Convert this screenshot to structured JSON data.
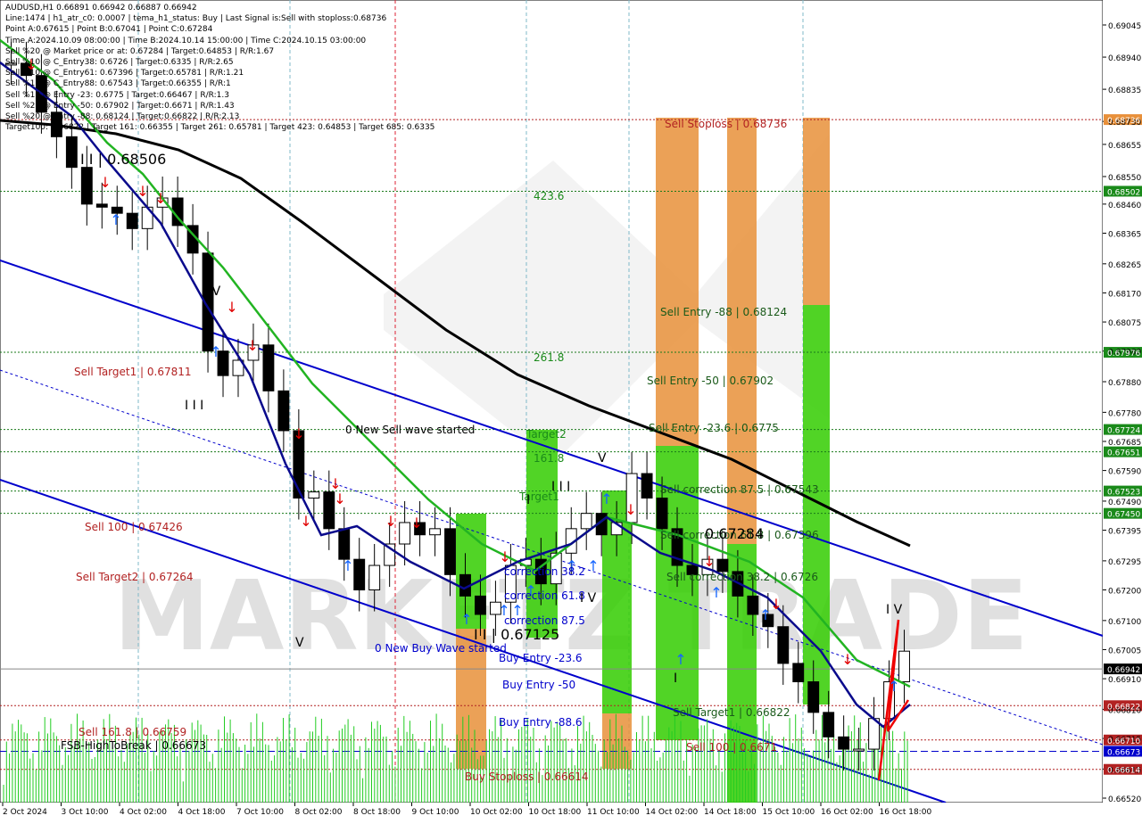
{
  "header": {
    "lines": [
      "AUDUSD,H1  0.66891 0.66942 0.66887 0.66942",
      "Line:1474 | h1_atr_c0: 0.0007 | tema_h1_status: Buy | Last Signal is:Sell with stoploss:0.68736",
      "Point A:0.67615 | Point B:0.67041 | Point C:0.67284",
      "Time A:2024.10.09 08:00:00 | Time B:2024.10.14 15:00:00 | Time C:2024.10.15 03:00:00",
      "Sell %20 @ Market price or at: 0.67284 | Target:0.64853 | R/R:1.67",
      "Sell %10 @ C_Entry38: 0.6726 | Target:0.6335 | R/R:2.65",
      "Sell %10 @ C_Entry61: 0.67396 | Target:0.65781 | R/R:1.21",
      "Sell %10 @ C_Entry88: 0.67543 | Target:0.66355 | R/R:1",
      "Sell %10 @ Entry -23: 0.6775 | Target:0.66467 | R/R:1.3",
      "Sell %20 @ Entry -50: 0.67902 | Target:0.6671 | R/R:1.43",
      "Sell %20 @ Entry -88: 0.68124 | Target:0.66822 | R/R:2.13",
      "Target100: 0.66822 | Target 161: 0.66355 | Target 261: 0.65781 | Target 423: 0.64853 | Target 685: 0.6335"
    ]
  },
  "watermark": "MARKETZ TRADE",
  "colors": {
    "background": "#ffffff",
    "bull_candle": "#000000",
    "bear_candle": "#000000",
    "ma_green": "#22b422",
    "ma_navy": "#0a0a8c",
    "ma_black": "#000000",
    "channel": "#0000cc",
    "dashed_red": "#b22222",
    "dashed_green": "#1a7a1a",
    "zone_green": "#33cc00",
    "zone_orange": "#e8903a",
    "label_red": "#b22222",
    "label_green": "#1a8a1a",
    "arrow_red": "#e00000",
    "arrow_blue": "#1565ff"
  },
  "price_axis": {
    "ticks": [
      "0.69045",
      "0.68940",
      "0.68835",
      "0.68730",
      "0.68655",
      "0.68550",
      "0.68460",
      "0.68365",
      "0.68265",
      "0.68170",
      "0.68075",
      "0.67980",
      "0.67880",
      "0.67780",
      "0.67685",
      "0.67590",
      "0.67490",
      "0.67395",
      "0.67295",
      "0.67200",
      "0.67100",
      "0.67005",
      "0.66910",
      "0.66810",
      "0.66715",
      "0.66615",
      "0.66520"
    ],
    "highlights": [
      {
        "label": "0.68736",
        "color": "#e8903a"
      },
      {
        "label": "0.68502",
        "color": "#1a8a1a"
      },
      {
        "label": "0.67976",
        "color": "#1a8a1a"
      },
      {
        "label": "0.67724",
        "color": "#1a8a1a"
      },
      {
        "label": "0.67651",
        "color": "#1a8a1a"
      },
      {
        "label": "0.67523",
        "color": "#1a8a1a"
      },
      {
        "label": "0.67450",
        "color": "#1a8a1a"
      },
      {
        "label": "0.66942",
        "color": "#000000"
      },
      {
        "label": "0.66822",
        "color": "#b22222"
      },
      {
        "label": "0.66710",
        "color": "#b22222"
      },
      {
        "label": "0.66673",
        "color": "#0000cc"
      },
      {
        "label": "0.66614",
        "color": "#b22222"
      }
    ]
  },
  "time_axis": {
    "labels": [
      "2 Oct 2024",
      "3 Oct 10:00",
      "4 Oct 02:00",
      "4 Oct 18:00",
      "7 Oct 10:00",
      "8 Oct 02:00",
      "8 Oct 18:00",
      "9 Oct 10:00",
      "10 Oct 02:00",
      "10 Oct 18:00",
      "11 Oct 10:00",
      "14 Oct 02:00",
      "14 Oct 18:00",
      "15 Oct 10:00",
      "16 Oct 02:00",
      "16 Oct 18:00"
    ]
  },
  "annotations": [
    {
      "text": "Sell Stoploss | 0.68736",
      "color": "#b22222"
    },
    {
      "text": "423.6",
      "color": "#1a8a1a"
    },
    {
      "text": "261.8",
      "color": "#1a8a1a"
    },
    {
      "text": "Sell Entry -88 | 0.68124",
      "color": "#1a5a1a"
    },
    {
      "text": "Sell Entry -50 | 0.67902",
      "color": "#1a5a1a"
    },
    {
      "text": "Sell Entry -23.6 | 0.6775",
      "color": "#1a5a1a"
    },
    {
      "text": "Sell correction 87.5 | 0.67543",
      "color": "#1a5a1a"
    },
    {
      "text": "Sell correction 61.8 | 0.67396",
      "color": "#1a5a1a"
    },
    {
      "text": "Sell correction 38.2 | 0.6726",
      "color": "#1a5a1a"
    },
    {
      "text": "0.67284",
      "color": "#000000"
    },
    {
      "text": "Sell Target1 | 0.66822",
      "color": "#1a5a1a"
    },
    {
      "text": "Sell 100 | 0.6671",
      "color": "#b22222"
    },
    {
      "text": "Sell Target1 | 0.67811",
      "color": "#b22222"
    },
    {
      "text": "Sell 100 | 0.67426",
      "color": "#b22222"
    },
    {
      "text": "Sell Target2 | 0.67264",
      "color": "#b22222"
    },
    {
      "text": "Sell 161.8 | 0.66759",
      "color": "#b22222"
    },
    {
      "text": "FSB-HighToBreak | 0.66673",
      "color": "#000000"
    },
    {
      "text": "0 New Sell wave started",
      "color": "#000000"
    },
    {
      "text": "0 New Buy Wave started",
      "color": "#0000cc"
    },
    {
      "text": "Buy Entry -23.6",
      "color": "#0000cc"
    },
    {
      "text": "Buy Entry -50",
      "color": "#0000cc"
    },
    {
      "text": "Buy Entry -88.6",
      "color": "#0000cc"
    },
    {
      "text": "Buy Stoploss | 0.66614",
      "color": "#b22222"
    },
    {
      "text": "correction 38.2",
      "color": "#0000cc"
    },
    {
      "text": "correction 61.8",
      "color": "#0000cc"
    },
    {
      "text": "correction 87.5",
      "color": "#0000cc"
    },
    {
      "text": "I I | 0.67125",
      "color": "#000000"
    },
    {
      "text": "I I | 0.68506",
      "color": "#000000"
    },
    {
      "text": "Target2",
      "color": "#1a8a1a"
    },
    {
      "text": "Target1",
      "color": "#1a8a1a"
    },
    {
      "text": "161.8",
      "color": "#1a8a1a"
    },
    {
      "text": "I V",
      "color": "#000000"
    },
    {
      "text": "I I I",
      "color": "#000000"
    },
    {
      "text": "V",
      "color": "#000000"
    },
    {
      "text": "I I I",
      "color": "#000000"
    },
    {
      "text": "V",
      "color": "#000000"
    },
    {
      "text": "I V",
      "color": "#000000"
    },
    {
      "text": "I V",
      "color": "#000000"
    },
    {
      "text": "I",
      "color": "#000000"
    },
    {
      "text": "I",
      "color": "#000000"
    }
  ],
  "chart_data": {
    "type": "candlestick",
    "symbol": "AUDUSD,H1",
    "ylim": [
      0.6652,
      0.69045
    ],
    "x": [
      "2 Oct 2024",
      "3 Oct 10:00",
      "4 Oct 02:00",
      "4 Oct 18:00",
      "7 Oct 10:00",
      "8 Oct 02:00",
      "8 Oct 18:00",
      "9 Oct 10:00",
      "10 Oct 02:00",
      "10 Oct 18:00",
      "11 Oct 10:00",
      "14 Oct 02:00",
      "14 Oct 18:00",
      "15 Oct 10:00",
      "16 Oct 02:00",
      "16 Oct 18:00"
    ],
    "close_path": [
      0.6892,
      0.6888,
      0.6876,
      0.6868,
      0.6858,
      0.6846,
      0.6845,
      0.6843,
      0.6838,
      0.6845,
      0.6848,
      0.6839,
      0.683,
      0.6798,
      0.679,
      0.6795,
      0.68,
      0.6785,
      0.6772,
      0.675,
      0.6752,
      0.674,
      0.673,
      0.672,
      0.6728,
      0.6735,
      0.6742,
      0.6738,
      0.674,
      0.6725,
      0.6718,
      0.6712,
      0.6716,
      0.6728,
      0.673,
      0.6722,
      0.6732,
      0.674,
      0.6745,
      0.6738,
      0.6742,
      0.6758,
      0.675,
      0.674,
      0.6728,
      0.6725,
      0.673,
      0.6726,
      0.6718,
      0.6712,
      0.6708,
      0.6696,
      0.669,
      0.668,
      0.6672,
      0.6668,
      0.6668,
      0.6678,
      0.669,
      0.67
    ],
    "last_price": 0.66942,
    "levels": {
      "sell_stoploss": 0.68736,
      "level_423": 0.68502,
      "level_261": 0.67976,
      "sell_entry_23": 0.67724,
      "sell_entry_651": 0.67651,
      "sell_corr_875": 0.67523,
      "sell_100_right": 0.6745,
      "sell_target1": 0.66822,
      "sell_100": 0.6671,
      "fsb_high": 0.66673,
      "buy_stoploss": 0.66614
    }
  }
}
